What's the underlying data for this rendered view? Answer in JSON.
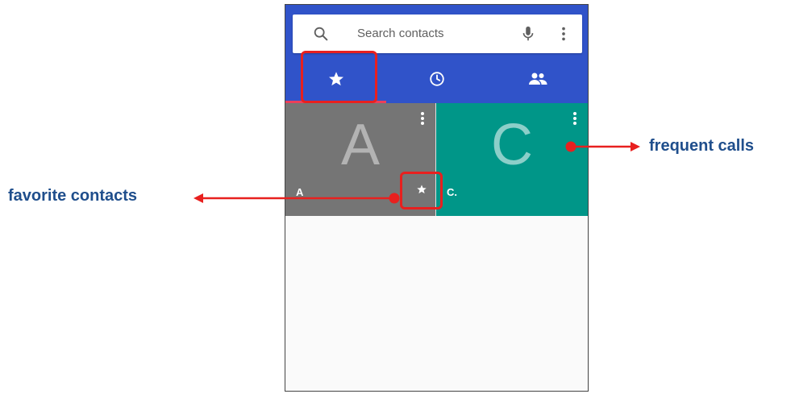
{
  "search": {
    "placeholder": "Search contacts"
  },
  "tabs": [
    {
      "name": "favorites",
      "icon": "star-icon",
      "selected": true
    },
    {
      "name": "recents",
      "icon": "clock-icon",
      "selected": false
    },
    {
      "name": "contacts",
      "icon": "people-icon",
      "selected": false
    }
  ],
  "tiles": [
    {
      "letter": "A",
      "name": "A",
      "color": "#757575",
      "starred": true
    },
    {
      "letter": "C",
      "name": "C.",
      "color": "#009688",
      "starred": false
    }
  ],
  "annotations": {
    "favorite": "favorite contacts",
    "frequent": "frequent calls",
    "color": "#e8201f",
    "label_color": "#1f4e8c"
  },
  "colors": {
    "appbar": "#3053c9",
    "tab_indicator": "#ec3f5a"
  }
}
